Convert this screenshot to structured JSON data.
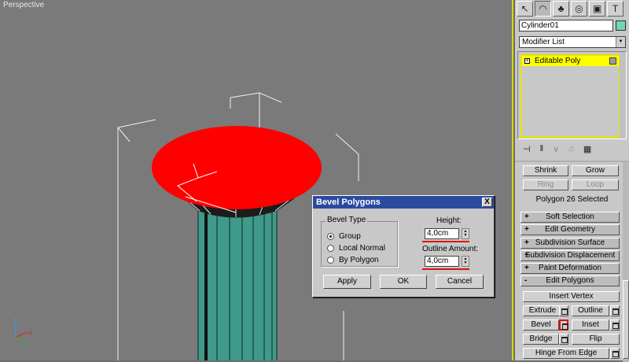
{
  "viewport": {
    "label": "Perspective"
  },
  "dialog": {
    "title": "Bevel Polygons",
    "close_glyph": "X",
    "bevel_type_label": "Bevel Type",
    "options": [
      "Group",
      "Local Normal",
      "By Polygon"
    ],
    "selected_option": "Group",
    "height_label": "Height:",
    "height_value": "4,0cm",
    "outline_label": "Outline Amount:",
    "outline_value": "4,0cm",
    "apply_label": "Apply",
    "ok_label": "OK",
    "cancel_label": "Cancel"
  },
  "panel": {
    "tabs": [
      "create-icon",
      "modify-icon",
      "hierarchy-icon",
      "motion-icon",
      "display-icon",
      "utilities-icon"
    ],
    "object_name": "Cylinder01",
    "object_color": "#6fd6b7",
    "modifier_list_label": "Modifier List",
    "stack_item": "Editable Poly",
    "selection": {
      "shrink_label": "Shrink",
      "grow_label": "Grow",
      "ring_label": "Ring",
      "loop_label": "Loop",
      "status": "Polygon 26 Selected"
    },
    "rollouts": [
      {
        "sign": "+",
        "label": "Soft Selection"
      },
      {
        "sign": "+",
        "label": "Edit Geometry"
      },
      {
        "sign": "+",
        "label": "Subdivision Surface"
      },
      {
        "sign": "+",
        "label": "Subdivision Displacement"
      },
      {
        "sign": "+",
        "label": "Paint Deformation"
      },
      {
        "sign": "-",
        "label": "Edit Polygons"
      }
    ],
    "edit_polygons": {
      "insert_vertex": "Insert Vertex",
      "extrude": "Extrude",
      "outline": "Outline",
      "bevel": "Bevel",
      "inset": "Inset",
      "bridge": "Bridge",
      "flip": "Flip",
      "hinge": "Hinge From Edge"
    }
  },
  "colors": {
    "selected_face": "#ff0000",
    "cylinder": "#3f9a8a",
    "highlight": "#ffff00"
  }
}
